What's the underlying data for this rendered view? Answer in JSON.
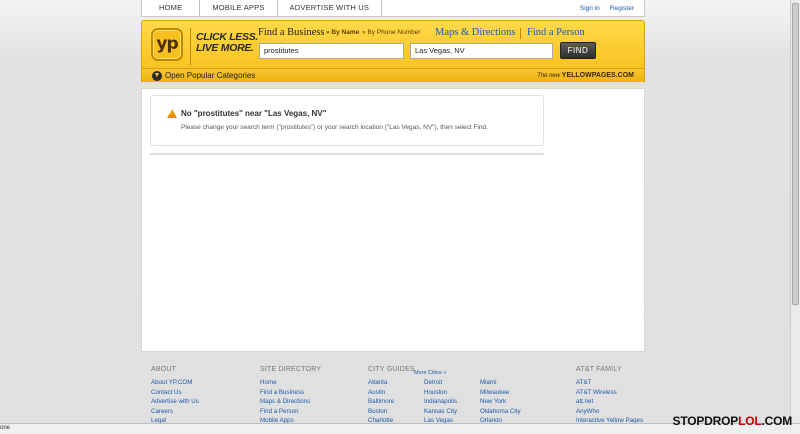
{
  "topnav": {
    "tabs": [
      "HOME",
      "MOBILE APPS",
      "ADVERTISE WITH US"
    ],
    "sign_in": "Sign in",
    "register": "Register"
  },
  "header": {
    "logo": "yp",
    "tagline_1": "CLICK LESS.",
    "tagline_2": "LIVE MORE.",
    "find_business": "Find a Business",
    "by_name": "» By Name",
    "by_phone": "» By Phone Number",
    "maps": "Maps & Directions",
    "find_person": "Find a Person",
    "search_value": "prostitutes",
    "location_value": "Las Vegas, NV",
    "find_button": "FIND",
    "categories_label": "Open Popular Categories",
    "new_yp_prefix": "The new",
    "new_yp_site": "YELLOWPAGES.COM"
  },
  "result": {
    "title": "No \"prostitutes\" near \"Las Vegas, NV\"",
    "body": "Please change your search term (\"prostitutes\") or your search location (\"Las Vegas, NV\"), then select Find."
  },
  "footer": {
    "about": {
      "title": "ABOUT",
      "links": [
        "About YP.COM",
        "Contact Us",
        "Advertise with Us",
        "Careers",
        "Legal"
      ]
    },
    "site_directory": {
      "title": "SITE DIRECTORY",
      "links": [
        "Home",
        "Find a Business",
        "Maps & Directions",
        "Find a Person",
        "Mobile Apps"
      ]
    },
    "city_guides": {
      "title": "CITY GUIDES",
      "more": "More Cities »",
      "col1": [
        "Atlanta",
        "Austin",
        "Baltimore",
        "Boston",
        "Charlotte"
      ],
      "col2": [
        "Detroit",
        "Houston",
        "Indianapolis",
        "Kansas City",
        "Las Vegas"
      ],
      "col3": [
        "Miami",
        "Milwaukee",
        "New York",
        "Oklahoma City",
        "Orlando"
      ]
    },
    "att_family": {
      "title": "AT&T FAMILY",
      "links": [
        "AT&T",
        "AT&T Wireless",
        "att.net",
        "AnyWho",
        "Interactive Yellow Pages"
      ]
    }
  },
  "status_bar": "one",
  "watermark": {
    "part1": "STOPDROP",
    "part2": "LOL",
    "part3": ".COM"
  },
  "colors": {
    "brand_yellow": "#f6bd16",
    "link_blue": "#1d5aa8",
    "warning": "#f08a00"
  }
}
